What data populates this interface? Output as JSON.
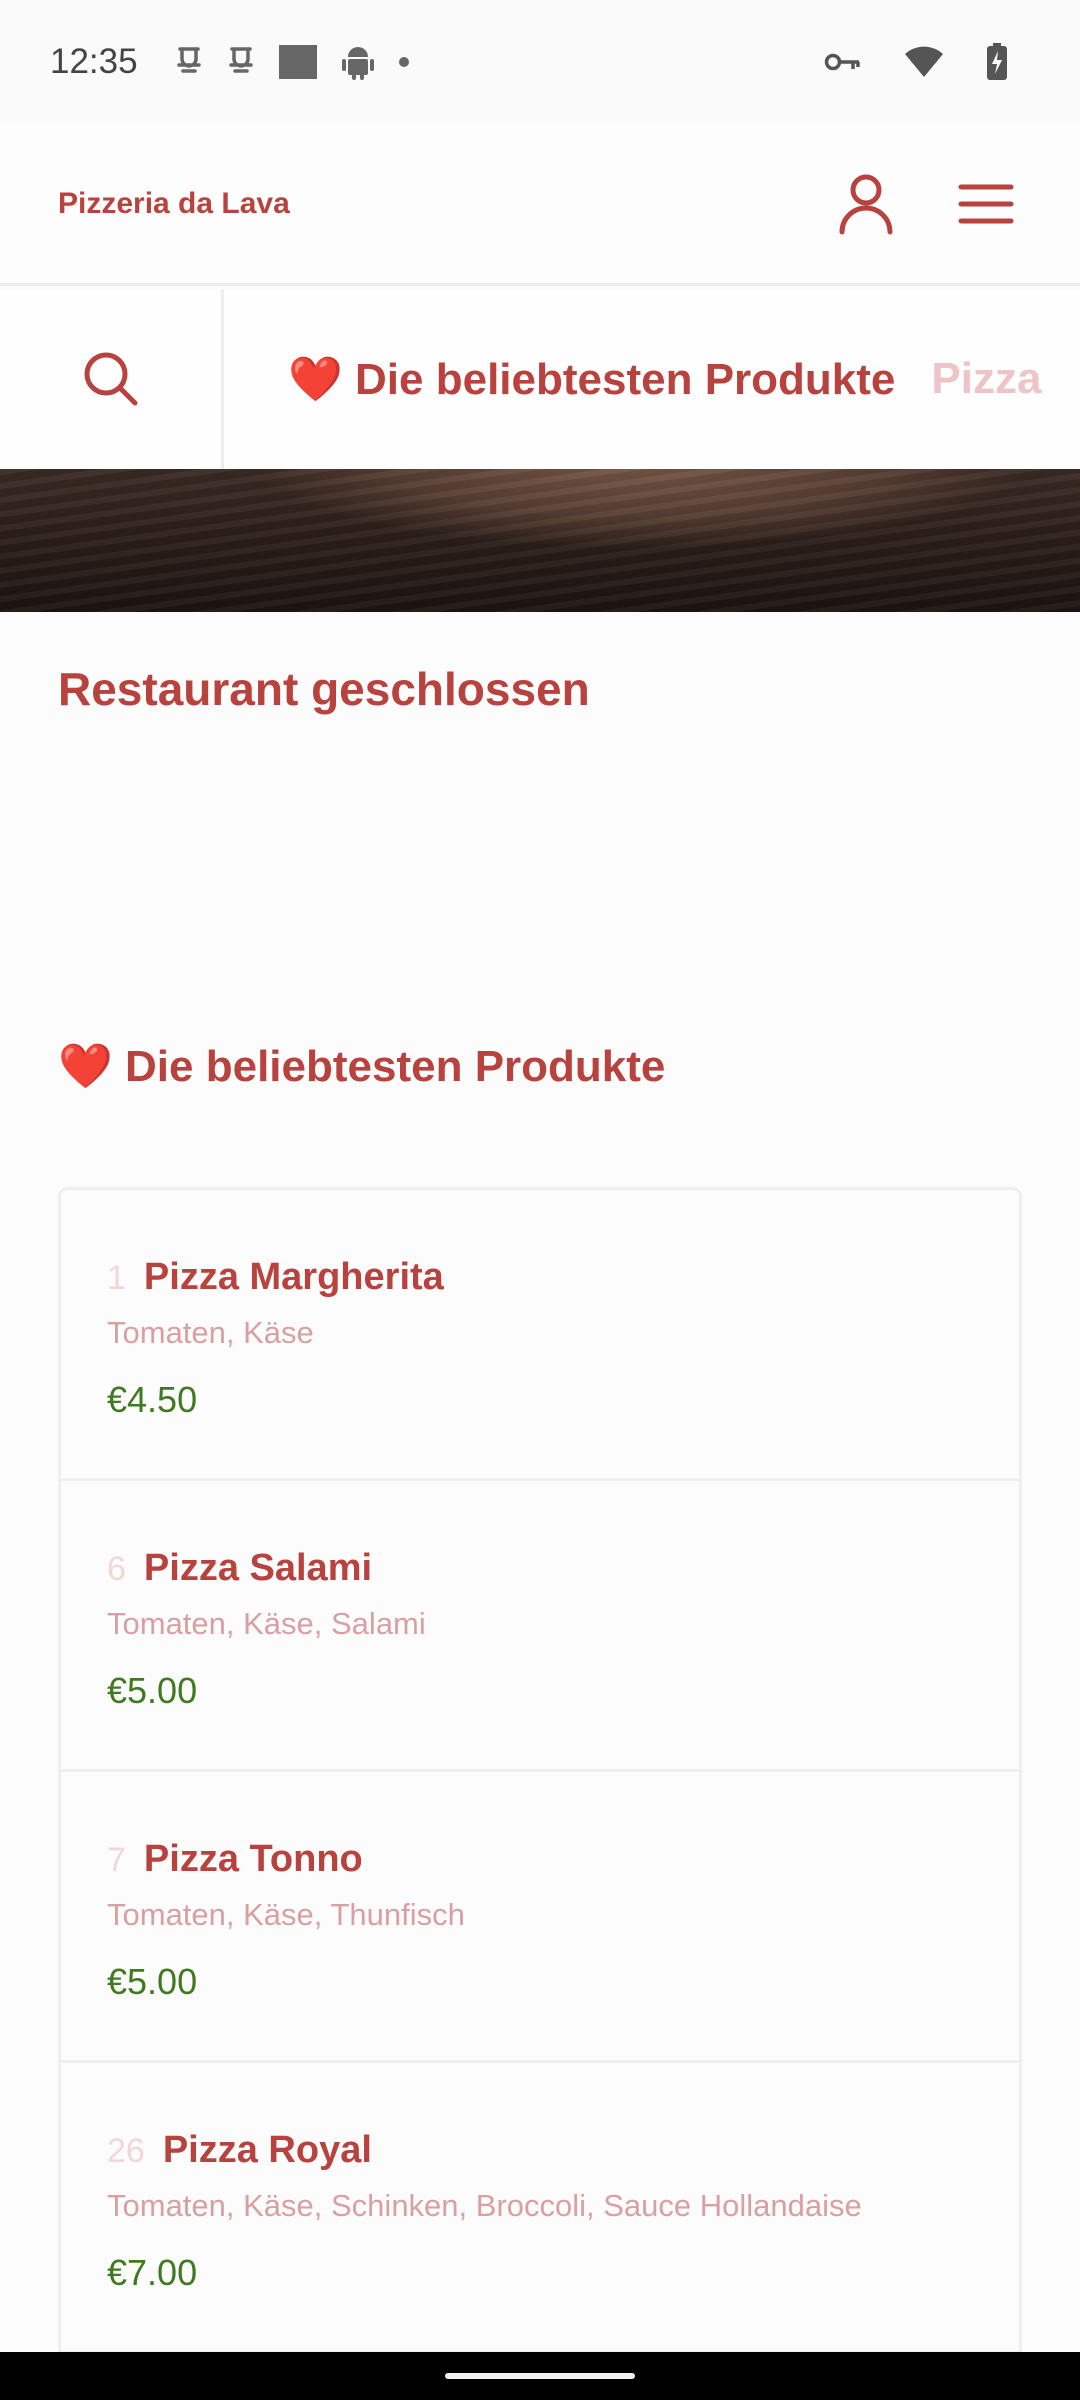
{
  "status_bar": {
    "time": "12:35",
    "left_icons": [
      "notification-icon",
      "notification-icon",
      "square-notification-icon",
      "android-icon",
      "dot-icon"
    ],
    "right_icons": [
      "vpn-key-icon",
      "wifi-icon",
      "battery-charging-icon"
    ]
  },
  "header": {
    "brand": "Pizzeria da Lava",
    "icons": [
      "user-icon",
      "menu-icon"
    ]
  },
  "categories": {
    "search_icon": "search-icon",
    "items": [
      {
        "emoji": "❤️",
        "label": "Die beliebtesten Produkte"
      },
      {
        "label": "Pizza"
      }
    ]
  },
  "restaurant_status": "Restaurant geschlossen",
  "section": {
    "emoji": "❤️",
    "title": "Die beliebtesten Produkte"
  },
  "products": [
    {
      "number": "1",
      "name": "Pizza Margherita",
      "description": "Tomaten, Käse",
      "price": "€4.50"
    },
    {
      "number": "6",
      "name": "Pizza Salami",
      "description": "Tomaten, Käse, Salami",
      "price": "€5.00"
    },
    {
      "number": "7",
      "name": "Pizza Tonno",
      "description": "Tomaten, Käse, Thunfisch",
      "price": "€5.00"
    },
    {
      "number": "26",
      "name": "Pizza Royal",
      "description": "Tomaten, Käse, Schinken, Broccoli, Sauce Hollandaise",
      "price": "€7.00"
    }
  ],
  "colors": {
    "accent": "#b8423e",
    "faded_accent": "#eec4c6",
    "price": "#3f7a21",
    "description": "#d9a0a2"
  }
}
